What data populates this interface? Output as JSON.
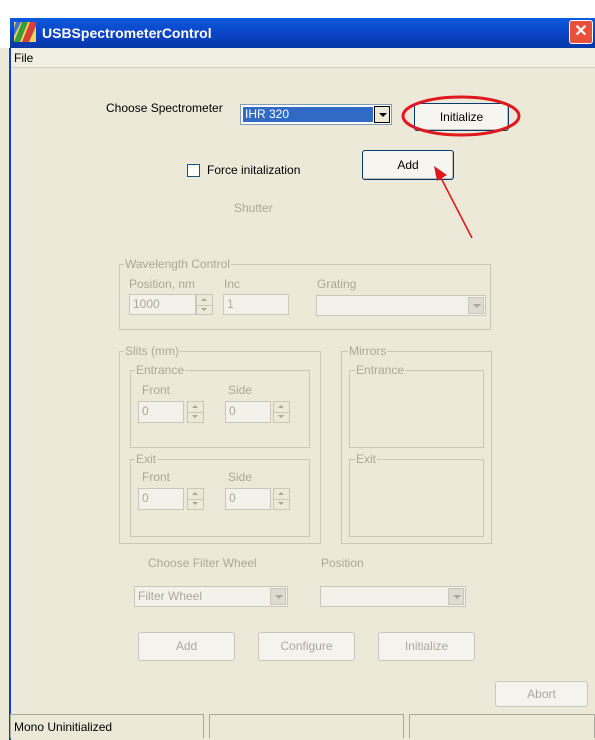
{
  "window": {
    "title": "USBSpectrometerControl",
    "close_symbol": "✕"
  },
  "menu": {
    "file": "File"
  },
  "spectrometer": {
    "choose_label": "Choose Spectrometer",
    "selected": "IHR 320",
    "initialize_button": "Initialize",
    "force_label": "Force initalization",
    "add_button": "Add",
    "shutter_label": "Shutter"
  },
  "wavelength": {
    "group_label": "Wavelength Control",
    "position_label": "Position, nm",
    "position_value": "1000",
    "inc_label": "Inc",
    "inc_value": "1",
    "grating_label": "Grating",
    "grating_value": ""
  },
  "slits": {
    "group_label": "Slits (mm)",
    "entrance_label": "Entrance",
    "exit_label": "Exit",
    "front_label": "Front",
    "side_label": "Side",
    "entrance_front": "0",
    "entrance_side": "0",
    "exit_front": "0",
    "exit_side": "0"
  },
  "mirrors": {
    "group_label": "Mirrors",
    "entrance_label": "Entrance",
    "exit_label": "Exit"
  },
  "filter_wheel": {
    "choose_label": "Choose Filter Wheel",
    "selected": "Filter Wheel",
    "position_label": "Position",
    "position_value": ""
  },
  "bottom_buttons": {
    "add": "Add",
    "configure": "Configure",
    "initialize": "Initialize",
    "abort": "Abort"
  },
  "status": {
    "pane1": "Mono Uninitialized",
    "pane2": "",
    "pane3": ""
  },
  "annotation": {
    "highlight_color": "#e0191e",
    "arrow_color": "#e0191e"
  }
}
